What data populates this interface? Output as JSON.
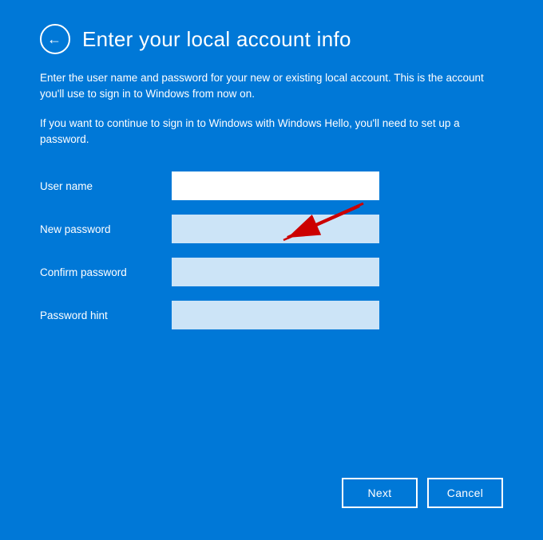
{
  "page": {
    "background_color": "#0078D7",
    "title": "Enter your local account info",
    "description1": "Enter the user name and password for your new or existing local account. This is the account you'll use to sign in to Windows from now on.",
    "description2": "If you want to continue to sign in to Windows with Windows Hello, you'll need to set up a password.",
    "back_button_label": "←",
    "form": {
      "fields": [
        {
          "label": "User name",
          "id": "username",
          "type": "text",
          "placeholder": ""
        },
        {
          "label": "New password",
          "id": "newpassword",
          "type": "password",
          "placeholder": ""
        },
        {
          "label": "Confirm password",
          "id": "confirmpassword",
          "type": "password",
          "placeholder": ""
        },
        {
          "label": "Password hint",
          "id": "passwordhint",
          "type": "text",
          "placeholder": ""
        }
      ]
    },
    "buttons": {
      "next_label": "Next",
      "cancel_label": "Cancel"
    }
  }
}
